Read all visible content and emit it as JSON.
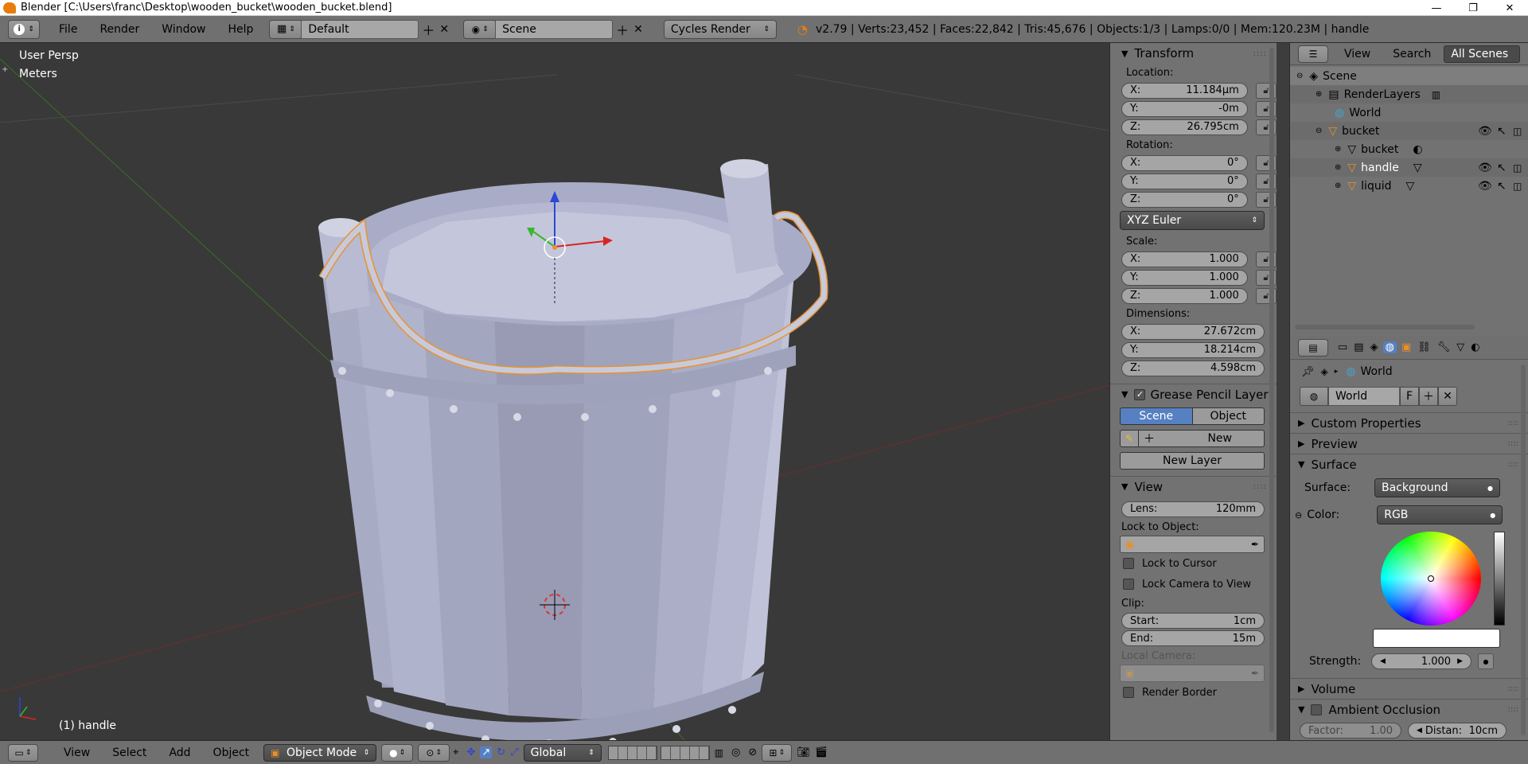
{
  "window": {
    "title": "Blender [C:\\Users\\franc\\Desktop\\wooden_bucket\\wooden_bucket.blend]",
    "minimize": "—",
    "maximize": "❐",
    "close": "✕"
  },
  "info_header": {
    "menus": [
      "File",
      "Render",
      "Window",
      "Help"
    ],
    "screen_layout": "Default",
    "scene": "Scene",
    "render_engine": "Cycles Render",
    "stats": "v2.79 | Verts:23,452 | Faces:22,842 | Tris:45,676 | Objects:1/3 | Lamps:0/0 | Mem:120.23M | handle"
  },
  "viewport": {
    "view_name": "User Persp",
    "units": "Meters",
    "active_object": "(1) handle"
  },
  "properties_panel": {
    "transform": {
      "header": "Transform",
      "location_label": "Location:",
      "location": [
        {
          "axis": "X:",
          "value": "11.184µm"
        },
        {
          "axis": "Y:",
          "value": "-0m"
        },
        {
          "axis": "Z:",
          "value": "26.795cm"
        }
      ],
      "rotation_label": "Rotation:",
      "rotation": [
        {
          "axis": "X:",
          "value": "0°"
        },
        {
          "axis": "Y:",
          "value": "0°"
        },
        {
          "axis": "Z:",
          "value": "0°"
        }
      ],
      "rotation_mode": "XYZ Euler",
      "scale_label": "Scale:",
      "scale": [
        {
          "axis": "X:",
          "value": "1.000"
        },
        {
          "axis": "Y:",
          "value": "1.000"
        },
        {
          "axis": "Z:",
          "value": "1.000"
        }
      ],
      "dimensions_label": "Dimensions:",
      "dimensions": [
        {
          "axis": "X:",
          "value": "27.672cm"
        },
        {
          "axis": "Y:",
          "value": "18.214cm"
        },
        {
          "axis": "Z:",
          "value": "4.598cm"
        }
      ]
    },
    "grease_pencil": {
      "header": "Grease Pencil Layer",
      "tab_scene": "Scene",
      "tab_object": "Object",
      "new_label": "New",
      "new_layer_label": "New Layer"
    },
    "view": {
      "header": "View",
      "lens_label": "Lens:",
      "lens_value": "120mm",
      "lock_to_object_label": "Lock to Object:",
      "lock_to_cursor": "Lock to Cursor",
      "lock_camera_to_view": "Lock Camera to View",
      "clip_label": "Clip:",
      "clip_start_label": "Start:",
      "clip_start_value": "1cm",
      "clip_end_label": "End:",
      "clip_end_value": "15m",
      "local_camera_label": "Local Camera:",
      "render_border": "Render Border"
    }
  },
  "outliner": {
    "view_menu": "View",
    "search_menu": "Search",
    "display_mode": "All Scenes",
    "items": [
      {
        "label": "Scene",
        "indent": 0
      },
      {
        "label": "RenderLayers",
        "indent": 1
      },
      {
        "label": "World",
        "indent": 1
      },
      {
        "label": "bucket",
        "indent": 1
      },
      {
        "label": "bucket",
        "indent": 2
      },
      {
        "label": "handle",
        "indent": 2
      },
      {
        "label": "liquid",
        "indent": 2
      }
    ]
  },
  "world_properties": {
    "context": "World",
    "datablock_name": "World",
    "fake_user": "F",
    "panels": {
      "custom_properties": "Custom Properties",
      "preview": "Preview",
      "surface": "Surface",
      "volume": "Volume",
      "ambient_occlusion": "Ambient Occlusion"
    },
    "surface_label": "Surface:",
    "surface_value": "Background",
    "color_label": "Color:",
    "color_value": "RGB",
    "strength_label": "Strength:",
    "strength_value": "1.000",
    "factor_label": "Factor:",
    "factor_value": "1.00",
    "distance_label": "Distan:",
    "distance_value": "10cm"
  },
  "bottom_header": {
    "menus": [
      "View",
      "Select",
      "Add",
      "Object"
    ],
    "mode": "Object Mode",
    "orientation": "Global"
  },
  "colors": {
    "header_bg": "#707070",
    "panel_bg": "#727272",
    "viewport_bg": "#393939",
    "selected_blue": "#5680c2",
    "selection_outline": "#e8932e"
  }
}
